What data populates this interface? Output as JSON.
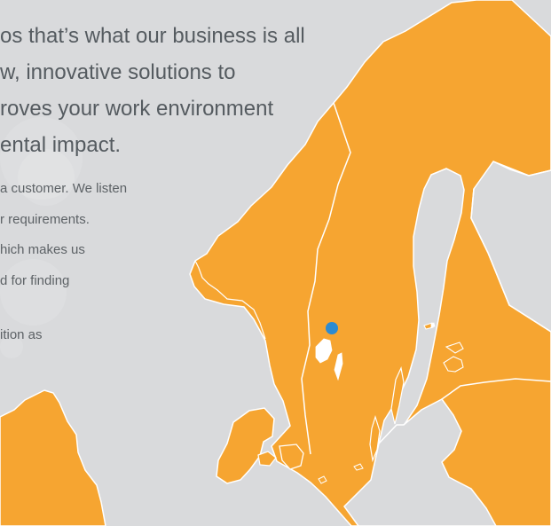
{
  "hero": {
    "headline_lines": [
      "os that’s what our business is all",
      "w, innovative solutions to",
      "roves your work environment",
      "ental impact."
    ],
    "body_lines": [
      "a customer. We listen",
      "r requirements.",
      "hich makes us",
      "d for finding",
      "ition as"
    ]
  },
  "map": {
    "land_color": "#f6a531",
    "sea_color": "#d9dadc",
    "border_color": "#ffffff",
    "marker_color": "#2d8bd0"
  }
}
